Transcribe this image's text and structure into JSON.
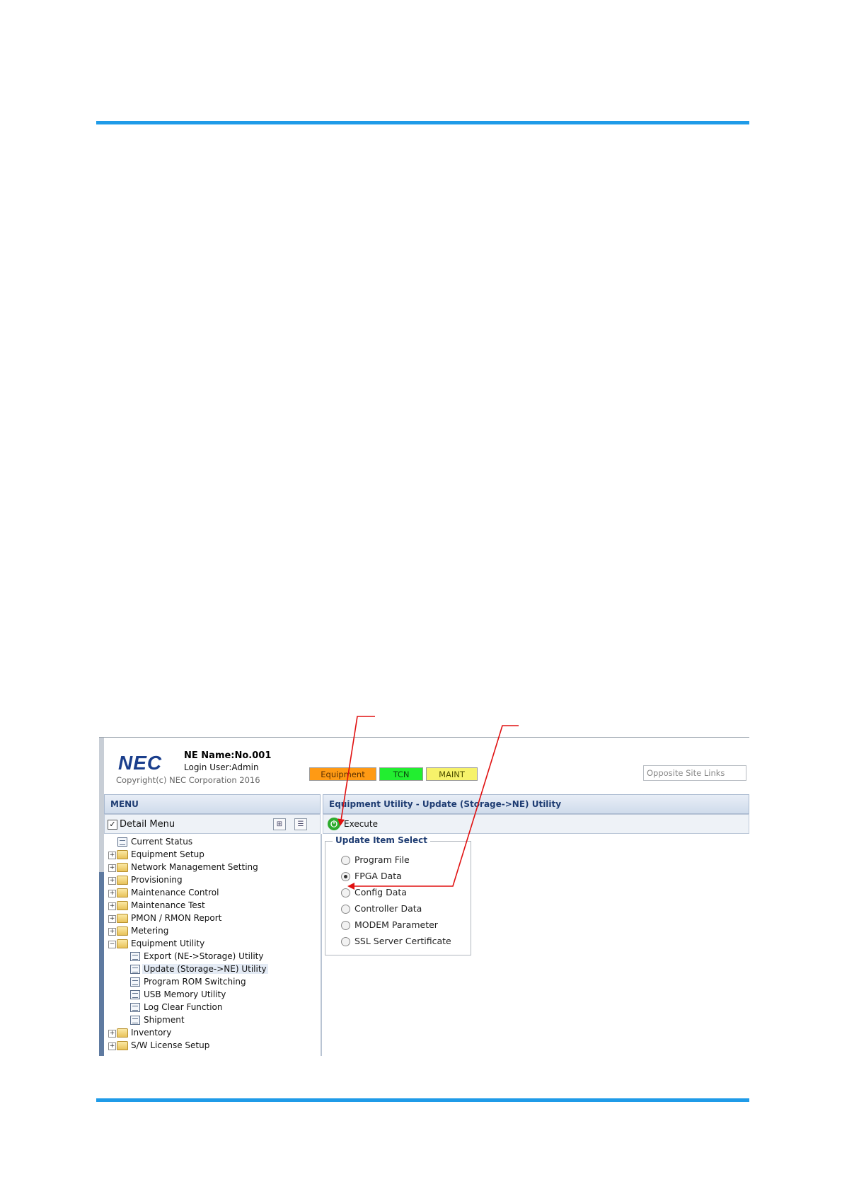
{
  "header": {
    "logo": "NEC",
    "ne_name": "NE Name:No.001",
    "login_user": "Login User:Admin",
    "copyright": "Copyright(c) NEC Corporation 2016",
    "badges": {
      "equipment": "Equipment",
      "tcn": "TCN",
      "maint": "MAINT"
    },
    "opposite_site_links": "Opposite Site Links"
  },
  "menu": {
    "title": "MENU",
    "detail_menu_label": "Detail Menu",
    "detail_menu_checked": true,
    "items": [
      {
        "label": "Current Status",
        "type": "page"
      },
      {
        "label": "Equipment Setup",
        "type": "folder"
      },
      {
        "label": "Network Management Setting",
        "type": "folder"
      },
      {
        "label": "Provisioning",
        "type": "folder"
      },
      {
        "label": "Maintenance Control",
        "type": "folder"
      },
      {
        "label": "Maintenance Test",
        "type": "folder"
      },
      {
        "label": "PMON / RMON Report",
        "type": "folder"
      },
      {
        "label": "Metering",
        "type": "folder"
      },
      {
        "label": "Equipment Utility",
        "type": "folder",
        "expanded": true
      },
      {
        "label": "Export (NE->Storage) Utility",
        "type": "page"
      },
      {
        "label": "Update (Storage->NE) Utility",
        "type": "page",
        "selected": true
      },
      {
        "label": "Program ROM Switching",
        "type": "page"
      },
      {
        "label": "USB Memory Utility",
        "type": "page"
      },
      {
        "label": "Log Clear Function",
        "type": "page"
      },
      {
        "label": "Shipment",
        "type": "page"
      },
      {
        "label": "Inventory",
        "type": "folder"
      },
      {
        "label": "S/W License Setup",
        "type": "folder"
      }
    ]
  },
  "content": {
    "title": "Equipment Utility - Update (Storage->NE) Utility",
    "execute_label": "Execute",
    "update_item_select": {
      "legend": "Update Item Select",
      "options": [
        "Program File",
        "FPGA Data",
        "Config Data",
        "Controller Data",
        "MODEM Parameter",
        "SSL Server Certificate"
      ],
      "selected": "FPGA Data"
    }
  },
  "colors": {
    "rule": "#1f9be8",
    "badge_equipment": "#ff9a14",
    "badge_tcn": "#22ee30",
    "badge_maint": "#f6f26a",
    "callout_arrow": "#e01010"
  }
}
